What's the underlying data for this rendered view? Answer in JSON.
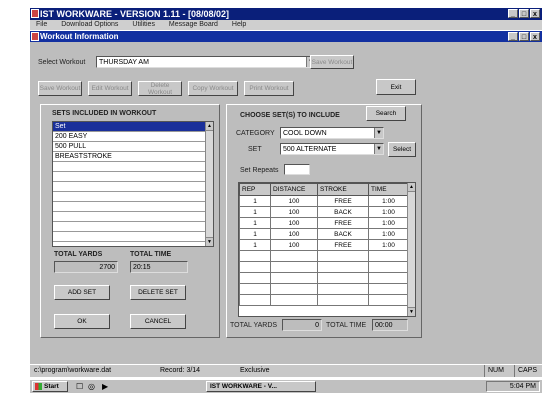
{
  "app": {
    "title": "IST WORKWARE - VERSION 1.11 - [08/08/02]",
    "window_buttons": [
      "_",
      "□",
      "x"
    ],
    "child_window_buttons": [
      "_",
      "□",
      "x"
    ]
  },
  "menu": [
    "File",
    "Download Options",
    "Utilities",
    "Message Board",
    "Help"
  ],
  "window": {
    "title": "Workout Information"
  },
  "top": {
    "select_label": "Select Workout",
    "select_value": "THURSDAY AM",
    "buttons": [
      "Save Workout",
      "Edit Workout",
      "Delete Workout",
      "Copy Workout",
      "Print Workout"
    ],
    "side_button": "Save Workout",
    "exit_label": "Exit"
  },
  "left": {
    "heading": "SETS INCLUDED IN WORKOUT",
    "sets": [
      "Set",
      "200 EASY",
      "500 PULL",
      "BREASTSTROKE"
    ],
    "total_yards_label": "TOTAL YARDS",
    "total_yards_value": "2700",
    "total_time_label": "TOTAL TIME",
    "total_time_value": "20:15",
    "add_set": "ADD SET",
    "delete_set": "DELETE SET",
    "ok": "OK",
    "cancel": "CANCEL"
  },
  "right": {
    "heading": "CHOOSE SET(S) TO INCLUDE",
    "search": "Search",
    "category_label": "CATEGORY",
    "category_value": "COOL DOWN",
    "set_label": "SET",
    "set_value": "500 ALTERNATE",
    "select_btn": "Select",
    "repeats_label": "Set Repeats",
    "table": {
      "headers": [
        "REP",
        "DISTANCE",
        "STROKE",
        "TIME"
      ],
      "rows": [
        [
          "1",
          "100",
          "FREE",
          "1:00"
        ],
        [
          "1",
          "100",
          "BACK",
          "1:00"
        ],
        [
          "1",
          "100",
          "FREE",
          "1:00"
        ],
        [
          "1",
          "100",
          "BACK",
          "1:00"
        ],
        [
          "1",
          "100",
          "FREE",
          "1:00"
        ]
      ]
    },
    "total_yards_label": "TOTAL YARDS",
    "total_yards_value": "0",
    "total_time_label": "TOTAL TIME",
    "total_time_value": "00:00"
  },
  "status": {
    "path": "c:\\program\\workware.dat",
    "record": "Record: 3/14",
    "mode": "Exclusive",
    "num": "NUM",
    "caps": "CAPS"
  },
  "taskbar": {
    "start": "Start",
    "task": "IST WORKWARE - V...",
    "clock": "5:04 PM"
  }
}
